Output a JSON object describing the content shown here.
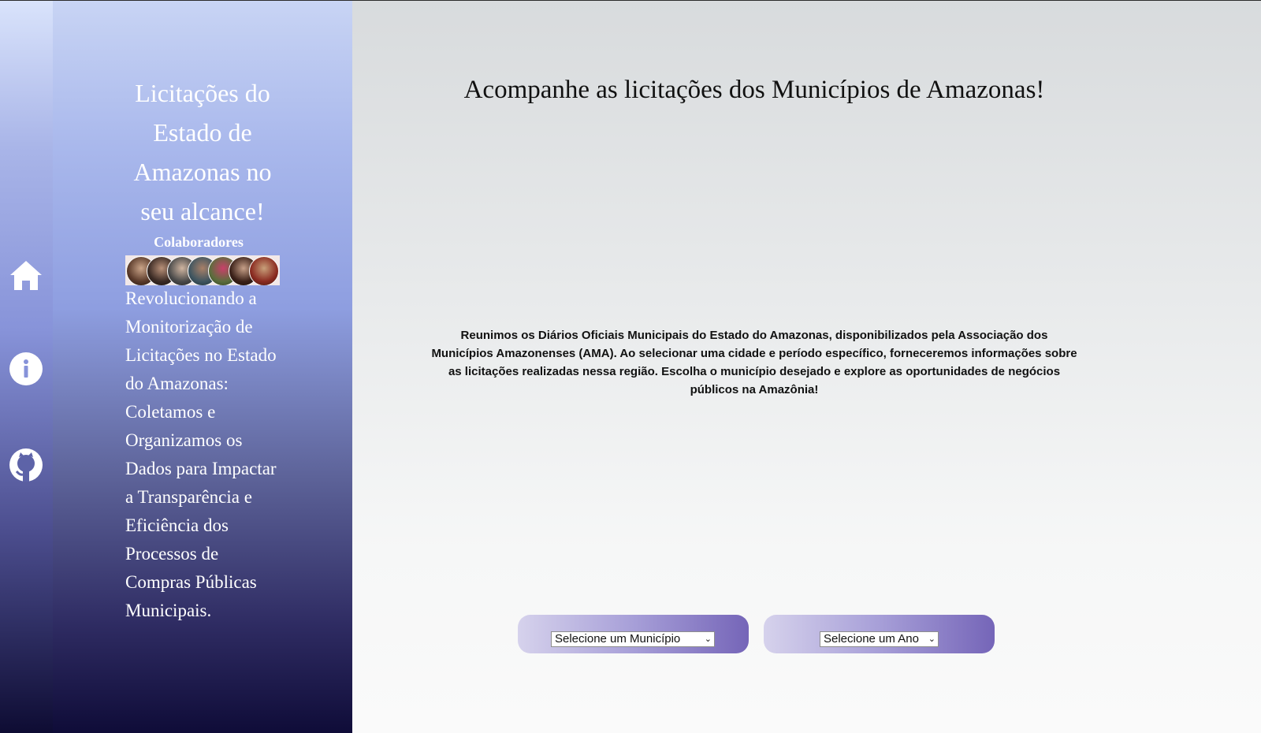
{
  "sidebar": {
    "title": "Licitações do Estado de Amazonas no seu alcance!",
    "collaborators_label": "Colaboradores",
    "mission": "Revolucionando a Monitorização de Licitações no Estado do Amazonas: Coletamos e Organizamos os Dados para Impactar a Transparência e Eficiência dos Processos de Compras Públicas Municipais."
  },
  "rail": {
    "icons": [
      "home-icon",
      "info-icon",
      "github-icon"
    ]
  },
  "main": {
    "title": "Acompanhe as licitações dos Municípios de Amazonas!",
    "description": "Reunimos os Diários Oficiais Municipais do Estado do Amazonas, disponibilizados pela Associação dos Municípios Amazonenses (AMA). Ao selecionar uma cidade e período específico, forneceremos informações sobre as licitações realizadas nessa região. Escolha o município desejado e explore as oportunidades de negócios públicos na Amazônia!",
    "municipio_select": "Selecione um Município",
    "ano_select": "Selecione um Ano"
  },
  "colors": {
    "pill_start": "#d6d2ec",
    "pill_end": "#7565b8",
    "sidebar_top": "#c8d4f4",
    "sidebar_bottom": "#0f0c38"
  }
}
